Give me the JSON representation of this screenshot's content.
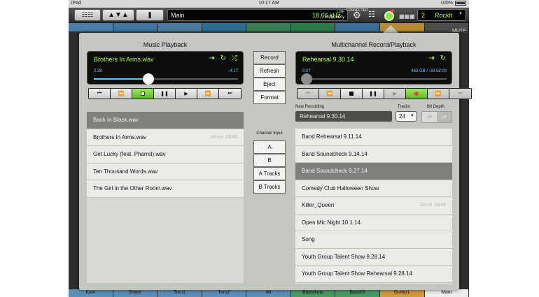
{
  "status_bar": {
    "device": "iPad",
    "time": "10:17 AM",
    "battery": "100%"
  },
  "toolbar": {
    "scene_name": "Main",
    "parameter_value": "18.66 kHz",
    "parameter_label_1": "LPF",
    "parameter_label_2": "Frequency",
    "connection_status": "CONNECTED",
    "user_number": "2",
    "user_name": "RockIt"
  },
  "mixer": {
    "mute_label": "MUTE",
    "bottom_tabs": [
      "Kick",
      "Snare",
      "Tom1",
      "Tom2",
      "Alt",
      "BassAmp",
      "BassDI",
      "Guitar1",
      "Main"
    ]
  },
  "music_playback": {
    "title": "Music Playback",
    "current_track": "Brothers In Arms.wav",
    "elapsed": "2:38",
    "remaining": "-4:17",
    "progress": 0.38,
    "files": [
      {
        "name": "Back In Black.wav",
        "meta": "",
        "selected": true
      },
      {
        "name": "Brothers In Arms.wav",
        "meta": "stereo 16/48",
        "selected": false
      },
      {
        "name": "Get Lucky (feat. Pharrel).wav",
        "meta": "",
        "selected": false
      },
      {
        "name": "Ten Thousand Words.wav",
        "meta": "",
        "selected": false
      },
      {
        "name": "The Girl in the Other Room.wav",
        "meta": "",
        "selected": false
      }
    ]
  },
  "middle_buttons": {
    "record": "Record",
    "refresh": "Refresh",
    "eject": "Eject",
    "format": "Format",
    "channel_input_label": "Channel Input",
    "channel_inputs": [
      "A",
      "B",
      "A Tracks",
      "B Tracks"
    ]
  },
  "multichannel": {
    "title": "Multichannel Record/Playback",
    "current_session": "Rehearsal 9.30.14",
    "elapsed": "0:07",
    "remaining": "463 GB / -39:58:09",
    "progress": 0.03,
    "new_recording_label": "New Recording",
    "new_recording_value": "Rehearsal 9.30.14",
    "tracks_label": "Tracks",
    "tracks_value": "24",
    "bit_depth_label": "Bit Depth",
    "bit_depth_options": [
      "16",
      "24"
    ],
    "sessions": [
      {
        "name": "Band Rehearsal 9.11.14",
        "meta": "",
        "selected": false
      },
      {
        "name": "Band Soundcheck 9.14.14",
        "meta": "",
        "selected": false
      },
      {
        "name": "Band Soundcheck 9.27.14",
        "meta": "",
        "selected": true
      },
      {
        "name": "Comedy Club Halloween Show",
        "meta": "",
        "selected": false
      },
      {
        "name": "Killer_Queen",
        "meta": "24-ch 16/48",
        "selected": false
      },
      {
        "name": "Open Mic Night 10.1.14",
        "meta": "",
        "selected": false
      },
      {
        "name": "Song",
        "meta": "",
        "selected": false
      },
      {
        "name": "Youth Group Talent Show 9.28.14",
        "meta": "",
        "selected": false
      },
      {
        "name": "Youth Group Talent Show Rehearsal 9.28.14",
        "meta": "",
        "selected": false
      }
    ]
  },
  "colors": {
    "accent_green": "#a9ff5a",
    "time_blue": "#6ec0f5",
    "record_red": "#e4462e"
  }
}
